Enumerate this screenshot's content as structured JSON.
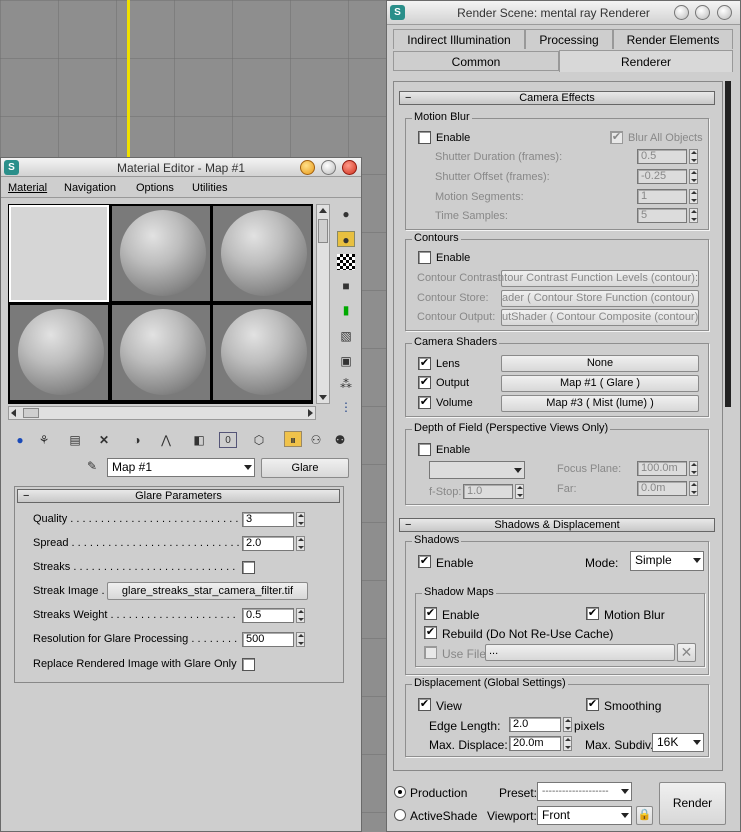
{
  "render": {
    "title": "Render Scene: mental ray Renderer",
    "tabs_row1": [
      "Indirect Illumination",
      "Processing",
      "Render Elements"
    ],
    "tabs_row2": [
      "Common",
      "Renderer"
    ],
    "camera_effects": {
      "header": "Camera Effects",
      "motion_blur": {
        "title": "Motion Blur",
        "enable": "Enable",
        "blur_all": "Blur All Objects",
        "shutter_duration": "Shutter Duration (frames):",
        "shutter_duration_val": "0.5",
        "shutter_offset": "Shutter Offset (frames):",
        "shutter_offset_val": "-0.25",
        "motion_segments": "Motion Segments:",
        "motion_segments_val": "1",
        "time_samples": "Time Samples:",
        "time_samples_val": "5"
      },
      "contours": {
        "title": "Contours",
        "enable": "Enable",
        "contrast": "Contour Contrast:",
        "contrast_val": ":ontour Contrast Function Levels (contour)",
        "store": "Contour Store:",
        "store_val": "ader  ( Contour Store Function (contour) )",
        "output": "Contour Output:",
        "output_val": "utShader  ( Contour Composite (contour) )"
      },
      "camera_shaders": {
        "title": "Camera Shaders",
        "lens": "Lens",
        "lens_val": "None",
        "output": "Output",
        "output_val": "Map #1  ( Glare )",
        "volume": "Volume",
        "volume_val": "Map #3  ( Mist (lume) )"
      },
      "dof": {
        "title": "Depth of Field (Perspective Views Only)",
        "enable": "Enable",
        "focus_plane": "Focus Plane:",
        "focus_plane_val": "100.0m",
        "fstop": "f-Stop:",
        "fstop_val": "1.0",
        "far": "Far:",
        "far_val": "0.0m"
      }
    },
    "shadows": {
      "header": "Shadows & Displacement",
      "title": "Shadows",
      "enable": "Enable",
      "mode_label": "Mode:",
      "mode_val": "Simple",
      "maps": {
        "title": "Shadow Maps",
        "enable": "Enable",
        "motion_blur": "Motion Blur",
        "rebuild": "Rebuild (Do Not Re-Use Cache)",
        "use_file": "Use File",
        "browse": "..."
      },
      "disp": {
        "title": "Displacement (Global Settings)",
        "view": "View",
        "smoothing": "Smoothing",
        "edge_length": "Edge Length:",
        "edge_length_val": "2.0",
        "pixels": "pixels",
        "max_displace": "Max. Displace:",
        "max_displace_val": "20.0m",
        "max_subdiv": "Max. Subdiv.:",
        "max_subdiv_val": "16K"
      }
    },
    "bottom": {
      "production": "Production",
      "activeshade": "ActiveShade",
      "preset": "Preset:",
      "preset_val": "--------------------",
      "viewport": "Viewport:",
      "viewport_val": "Front",
      "render": "Render"
    }
  },
  "material": {
    "title": "Material Editor - Map #1",
    "menu": [
      "Material",
      "Navigation",
      "Options",
      "Utilities"
    ],
    "map_name": "Map #1",
    "map_type": "Glare",
    "glare": {
      "header": "Glare Parameters",
      "quality": "Quality . . . . . . . . . . . . . . . . . . . . . . . . . . . . . . .",
      "quality_val": "3",
      "spread": "Spread . . . . . . . . . . . . . . . . . . . . . . . . . . . . . . . .",
      "spread_val": "2.0",
      "streaks": "Streaks . . . . . . . . . . . . . . . . . . . . . . . . . . . . . . .",
      "streak_image": "Streak Image . .",
      "streak_image_val": "glare_streaks_star_camera_filter.tif",
      "streaks_weight": "Streaks Weight . . . . . . . . . . . . . . . . . . . . . . . . .",
      "streaks_weight_val": "0.5",
      "resolution": "Resolution for Glare Processing . . . . . . . . .",
      "resolution_val": "500",
      "replace": "Replace Rendered Image with Glare Only . ."
    }
  }
}
